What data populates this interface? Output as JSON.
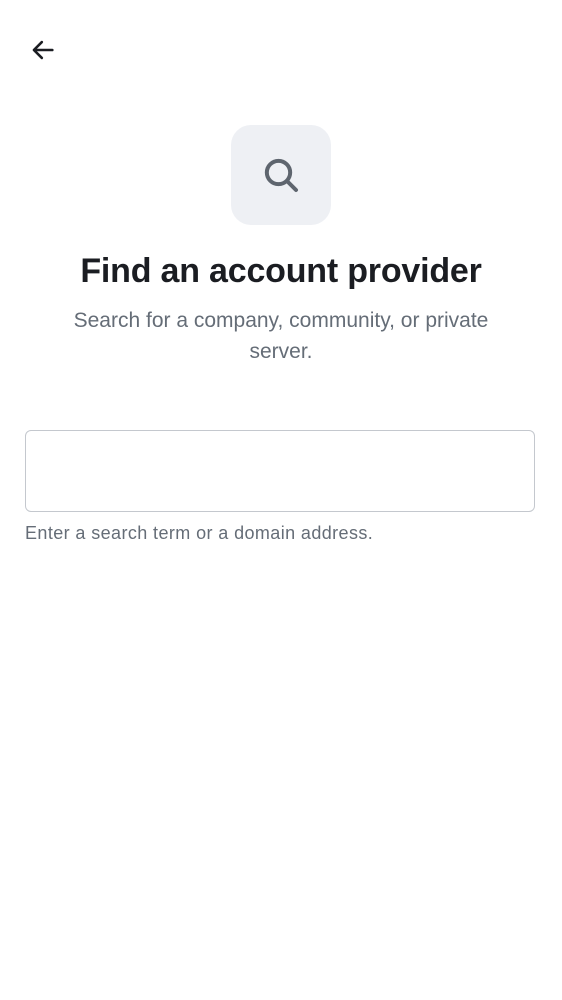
{
  "header": {
    "back_icon": "arrow-left-icon"
  },
  "hero": {
    "icon": "search-icon",
    "icon_bg": "#eef0f4",
    "icon_color": "#5e656e"
  },
  "title": "Find an account provider",
  "subtitle": "Search for a company, community, or private server.",
  "search": {
    "value": "",
    "placeholder": "",
    "helper": "Enter a search term or a domain address."
  },
  "colors": {
    "title": "#1b1d22",
    "secondary_text": "#656d77",
    "field_border": "#c4c8ce"
  }
}
